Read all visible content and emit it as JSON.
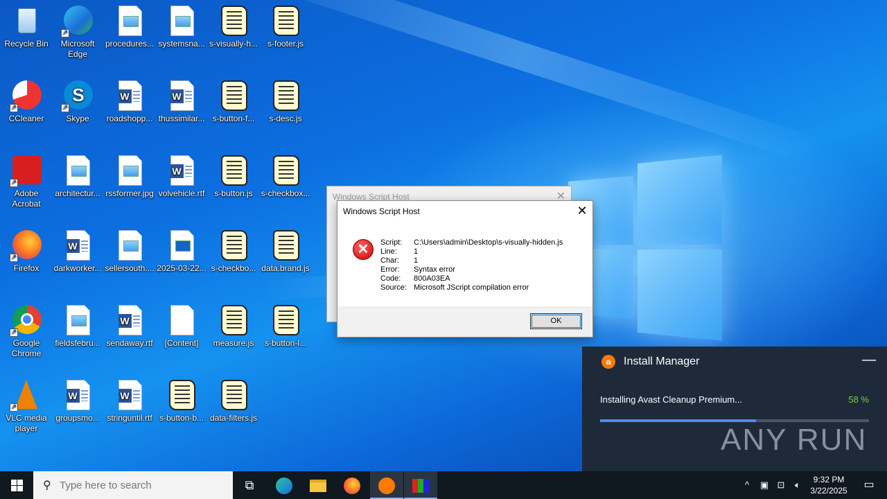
{
  "desktop": {
    "icons": [
      {
        "label": "Recycle Bin",
        "icon": "recycle-bin-icon"
      },
      {
        "label": "Microsoft Edge",
        "icon": "edge-icon"
      },
      {
        "label": "procedures...",
        "icon": "image-file-icon"
      },
      {
        "label": "systemsna...",
        "icon": "image-file-icon"
      },
      {
        "label": "s-visually-h...",
        "icon": "script-file-icon"
      },
      {
        "label": "s-footer.js",
        "icon": "script-file-icon"
      },
      {
        "label": "CCleaner",
        "icon": "ccleaner-icon"
      },
      {
        "label": "Skype",
        "icon": "skype-icon"
      },
      {
        "label": "roadshopp...",
        "icon": "word-file-icon"
      },
      {
        "label": "thussimilar...",
        "icon": "word-file-icon"
      },
      {
        "label": "s-button-f...",
        "icon": "script-file-icon"
      },
      {
        "label": "s-desc.js",
        "icon": "script-file-icon"
      },
      {
        "label": "Adobe Acrobat",
        "icon": "acrobat-icon"
      },
      {
        "label": "architectur...",
        "icon": "image-file-icon"
      },
      {
        "label": "rssformer.jpg",
        "icon": "image-file-icon"
      },
      {
        "label": "volvehicle.rtf",
        "icon": "word-file-icon"
      },
      {
        "label": "s-button.js",
        "icon": "script-file-icon"
      },
      {
        "label": "s-checkbox...",
        "icon": "script-file-icon"
      },
      {
        "label": "Firefox",
        "icon": "firefox-icon"
      },
      {
        "label": "darkworker...",
        "icon": "word-file-icon"
      },
      {
        "label": "sellersouth....",
        "icon": "image-file-icon"
      },
      {
        "label": "2025-03-22...",
        "icon": "screenshot-file-icon"
      },
      {
        "label": "s-checkbo...",
        "icon": "script-file-icon"
      },
      {
        "label": "data.brand.js",
        "icon": "script-file-icon"
      },
      {
        "label": "Google Chrome",
        "icon": "chrome-icon"
      },
      {
        "label": "fieldsfebru...",
        "icon": "image-file-icon"
      },
      {
        "label": "sendaway.rtf",
        "icon": "word-file-icon"
      },
      {
        "label": "[Content]",
        "icon": "blank-file-icon"
      },
      {
        "label": "measure.js",
        "icon": "script-file-icon"
      },
      {
        "label": "s-button-l...",
        "icon": "script-file-icon"
      },
      {
        "label": "VLC media player",
        "icon": "vlc-icon"
      },
      {
        "label": "groupsmo...",
        "icon": "word-file-icon"
      },
      {
        "label": "stringuntil.rtf",
        "icon": "word-file-icon"
      },
      {
        "label": "s-button-b...",
        "icon": "script-file-icon"
      },
      {
        "label": "data-filters.js",
        "icon": "script-file-icon"
      }
    ]
  },
  "background_dialog": {
    "title": "Windows Script Host"
  },
  "dialog": {
    "title": "Windows Script Host",
    "close": "✕",
    "rows": [
      {
        "key": "Script:",
        "value": "C:\\Users\\admin\\Desktop\\s-visually-hidden.js"
      },
      {
        "key": "Line:",
        "value": "1"
      },
      {
        "key": "Char:",
        "value": "1"
      },
      {
        "key": "Error:",
        "value": "Syntax error"
      },
      {
        "key": "Code:",
        "value": "800A03EA"
      },
      {
        "key": "Source:",
        "value": "Microsoft JScript compilation error"
      }
    ],
    "ok_label": "OK"
  },
  "install_manager": {
    "title": "Install Manager",
    "minimize": "—",
    "message": "Installing Avast Cleanup Premium...",
    "percent_label": "58 %",
    "progress": 0.58
  },
  "watermark": "ANY RUN",
  "taskbar": {
    "search_placeholder": "Type here to search",
    "time": "9:32 PM",
    "date": "3/22/2025"
  },
  "colors": {
    "accent": "#0078d7",
    "progress": "#4e8fe8",
    "percent": "#6fcf3c",
    "error": "#cc0000"
  }
}
